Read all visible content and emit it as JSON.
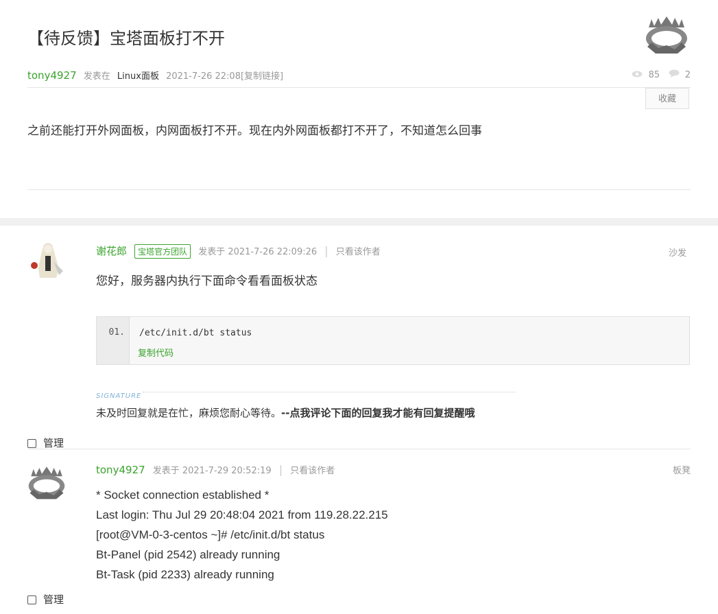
{
  "thread": {
    "title": "【待反馈】宝塔面板打不开",
    "author": "tony4927",
    "posted_in_label": "发表在",
    "forum": "Linux面板",
    "date": "2021-7-26 22:08",
    "copy_link": "[复制链接]",
    "views": "85",
    "replies": "2",
    "favorite_label": "收藏",
    "body": "之前还能打开外网面板，内网面板打不开。现在内外网面板都打不开了，不知道怎么回事"
  },
  "posts": [
    {
      "author": "谢花郎",
      "badge": "宝塔官方团队",
      "time": "发表于 2021-7-26 22:09:26",
      "only_author": "只看该作者",
      "floor": "沙发",
      "text": "您好，服务器内执行下面命令看看面板状态",
      "code": {
        "line_no": "01.",
        "line": "/etc/init.d/bt status",
        "copy_label": "复制代码"
      },
      "signature_label": "SIGNATURE",
      "signature_text": "未及时回复就是在忙，麻烦您耐心等待。",
      "signature_bold": "--点我评论下面的回复我才能有回复提醒哦",
      "manage_label": "管理"
    },
    {
      "author": "tony4927",
      "time": "发表于 2021-7-29 20:52:19",
      "only_author": "只看该作者",
      "floor": "板凳",
      "lines": [
        "* Socket connection established *",
        "Last login: Thu Jul 29 20:48:04 2021 from 119.28.22.215",
        "[root@VM-0-3-centos ~]# /etc/init.d/bt status",
        "Bt-Panel (pid 2542) already running",
        "Bt-Task (pid 2233) already running"
      ],
      "manage_label": "管理"
    }
  ],
  "icons": {
    "views": "eye-icon",
    "replies": "comment-icon"
  },
  "colors": {
    "accent": "#3aa32c",
    "muted": "#999999"
  }
}
